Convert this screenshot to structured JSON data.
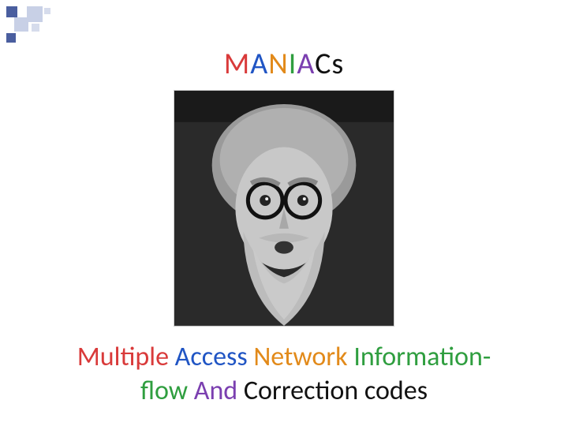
{
  "title_letters": {
    "m": "M",
    "a1": "A",
    "n": "N",
    "i": "I",
    "a2": "A",
    "c": "C",
    "s": "s"
  },
  "expansion": {
    "multiple": "Multiple",
    "sp1": " ",
    "access": "Access",
    "sp2": " ",
    "network": "Network",
    "sp3": " ",
    "information": "Information",
    "dash": "-",
    "br": "",
    "flow": "flow",
    "sp4": " ",
    "and": "And",
    "sp5": " ",
    "correction": "Correction",
    "sp6": " ",
    "codes": "codes"
  },
  "image_alt": "Black-and-white portrait of a man with round glasses, curly hair, mustache and beard, wide-eyed expression"
}
